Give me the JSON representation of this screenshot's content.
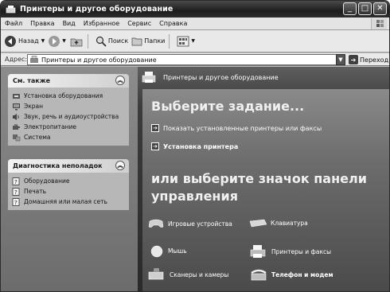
{
  "window": {
    "title": "Принтеры и другое оборудование",
    "buttons": {
      "minimize": "_",
      "maximize": "□",
      "close": "✕"
    }
  },
  "menu": [
    "Файл",
    "Правка",
    "Вид",
    "Избранное",
    "Сервис",
    "Справка"
  ],
  "toolbar": {
    "back": "Назад",
    "search": "Поиск",
    "folders": "Папки"
  },
  "address": {
    "label": "Адрес:",
    "value": "Принтеры и другое оборудование",
    "go": "Переход"
  },
  "sidebar": {
    "see_also": {
      "title": "См. также",
      "items": [
        {
          "label": "Установка оборудования",
          "icon": "hardware-install-icon"
        },
        {
          "label": "Экран",
          "icon": "display-icon"
        },
        {
          "label": "Звук, речь и аудиоустройства",
          "icon": "sound-icon"
        },
        {
          "label": "Электропитание",
          "icon": "power-icon"
        },
        {
          "label": "Система",
          "icon": "system-icon"
        }
      ]
    },
    "troubleshoot": {
      "title": "Диагностика неполадок",
      "items": [
        {
          "label": "Оборудование",
          "icon": "help-icon"
        },
        {
          "label": "Печать",
          "icon": "help-icon"
        },
        {
          "label": "Домашняя или малая сеть",
          "icon": "help-icon"
        }
      ]
    }
  },
  "main": {
    "header": "Принтеры и другое оборудование",
    "pick_task": "Выберите задание...",
    "tasks": [
      "Показать установленные принтеры или факсы",
      "Установка принтера"
    ],
    "or_pick": "или выберите значок панели управления",
    "cp_items": [
      {
        "label": "Игровые устройства",
        "icon": "gamepad-icon"
      },
      {
        "label": "Клавиатура",
        "icon": "keyboard-icon"
      },
      {
        "label": "Мышь",
        "icon": "mouse-icon"
      },
      {
        "label": "Принтеры и факсы",
        "icon": "printer-icon"
      },
      {
        "label": "Сканеры и камеры",
        "icon": "scanner-icon"
      },
      {
        "label": "Телефон и модем",
        "icon": "phone-icon"
      }
    ]
  }
}
